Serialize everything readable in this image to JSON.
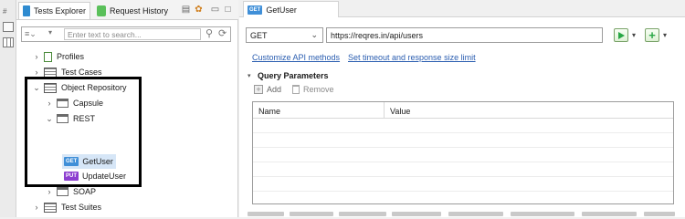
{
  "left_panel": {
    "tabs": [
      {
        "label": "Tests Explorer",
        "icon": "tests-explorer-icon",
        "active": true
      },
      {
        "label": "Request History",
        "icon": "request-history-icon",
        "active": false
      }
    ],
    "search": {
      "placeholder": "Enter text to search..."
    },
    "tree": [
      {
        "label": "Profiles",
        "icon": "profiles-icon",
        "expanded": false
      },
      {
        "label": "Test Cases",
        "icon": "test-cases-icon",
        "expanded": false
      },
      {
        "label": "Object Repository",
        "icon": "object-repository-icon",
        "expanded": true
      },
      {
        "label": "Capsule",
        "icon": "folder-icon",
        "expanded": false
      },
      {
        "label": "REST",
        "icon": "folder-icon",
        "expanded": true
      },
      {
        "label": "GetUser",
        "badge": "GET",
        "selected": true
      },
      {
        "label": "UpdateUser",
        "badge": "PUT"
      },
      {
        "label": "SOAP",
        "icon": "folder-icon",
        "expanded": false
      },
      {
        "label": "Test Suites",
        "icon": "test-suites-icon",
        "expanded": false
      }
    ]
  },
  "editor": {
    "tab": {
      "label": "GetUser",
      "badge": "GET"
    },
    "method": "GET",
    "url": "https://reqres.in/api/users",
    "links": {
      "customize": "Customize API methods",
      "timeout": "Set timeout and response size limit"
    },
    "query_params": {
      "title": "Query Parameters",
      "add_label": "Add",
      "remove_label": "Remove",
      "columns": [
        "Name",
        "Value"
      ]
    }
  },
  "colors": {
    "get_badge": "#3f8fd8",
    "put_badge": "#8d3fd0",
    "green_accent": "#28a745",
    "link": "#2a5db0",
    "highlight_border": "#000000"
  }
}
